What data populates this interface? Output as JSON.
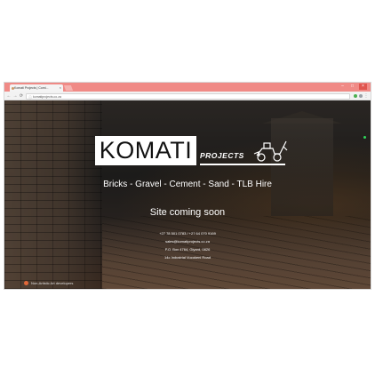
{
  "browser": {
    "tab_title": "Komati Projects | Comi...",
    "tab_close": "×",
    "url": "komatiprojects.co.za",
    "url_info_icon": "info-icon",
    "nav": {
      "back": "←",
      "forward": "→",
      "reload": "⟳"
    },
    "window_controls": {
      "minimize": "–",
      "maximize": "□",
      "close": "×"
    },
    "accent_color": "#f08a86"
  },
  "page": {
    "logo_main": "KOMATI",
    "logo_sub": "PROJECTS",
    "tagline": "Bricks - Gravel - Cement - Sand - TLB Hire",
    "status": "Site coming soon",
    "contact": {
      "phone": "+27 78 501 0783 / +27 64 070 9169",
      "email": "sales@komatiprojects.co.za",
      "postal": "P.O. Box 4764, Glyard, 0826",
      "address": "14c Industrial Vucokeni Road"
    },
    "footer": "Non-Artistic Art developers"
  }
}
